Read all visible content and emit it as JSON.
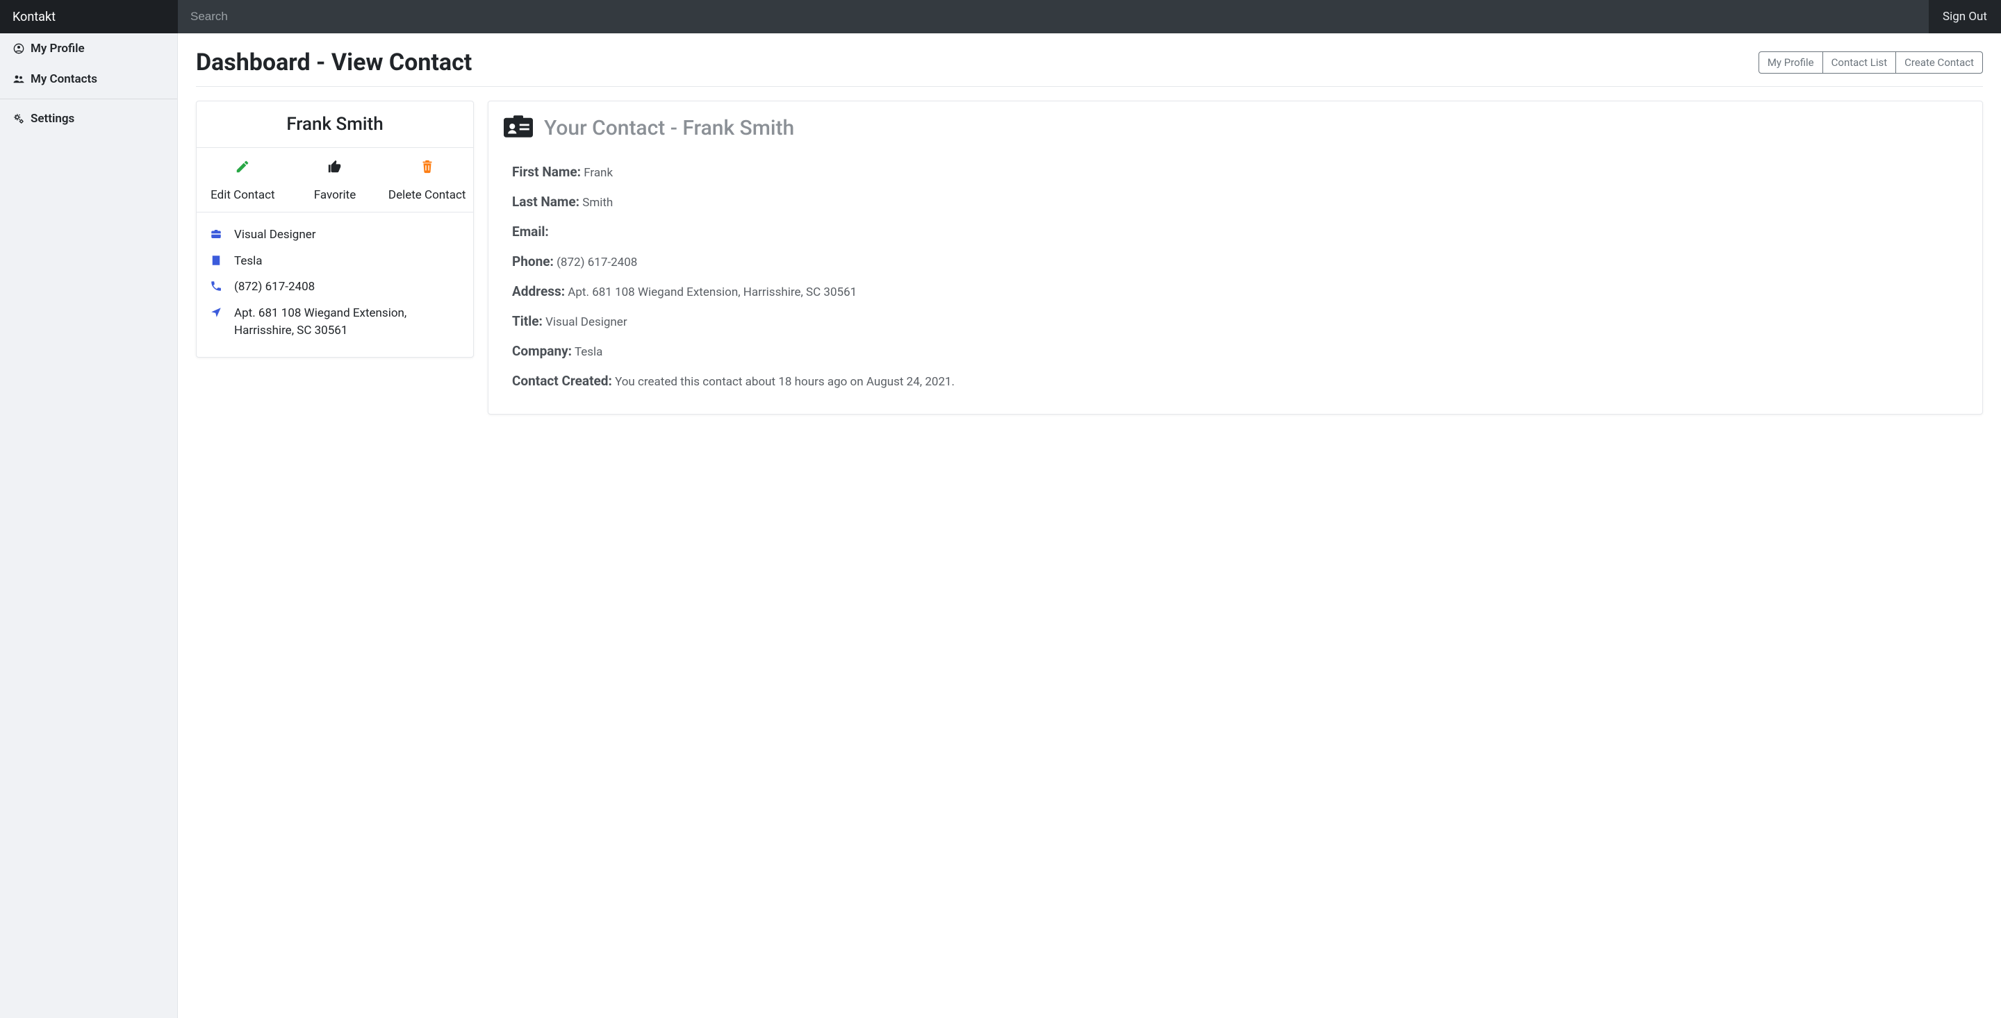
{
  "brand": "Kontakt",
  "search": {
    "placeholder": "Search"
  },
  "signout": "Sign Out",
  "sidebar": {
    "items": [
      {
        "label": "My Profile"
      },
      {
        "label": "My Contacts"
      },
      {
        "label": "Settings"
      }
    ]
  },
  "header": {
    "title": "Dashboard - View Contact",
    "buttons": [
      {
        "label": "My Profile"
      },
      {
        "label": "Contact List"
      },
      {
        "label": "Create Contact"
      }
    ]
  },
  "card": {
    "name": "Frank Smith",
    "actions": {
      "edit": "Edit Contact",
      "favorite": "Favorite",
      "delete": "Delete Contact"
    },
    "info": {
      "title": "Visual Designer",
      "company": "Tesla",
      "phone": "(872) 617-2408",
      "address": "Apt. 681 108 Wiegand Extension, Harrisshire, SC 30561"
    }
  },
  "details": {
    "heading": "Your Contact - Frank Smith",
    "labels": {
      "first_name": "First Name:",
      "last_name": "Last Name:",
      "email": "Email:",
      "phone": "Phone:",
      "address": "Address:",
      "title": "Title:",
      "company": "Company:",
      "created": "Contact Created:"
    },
    "values": {
      "first_name": "Frank",
      "last_name": "Smith",
      "email": "",
      "phone": "(872) 617-2408",
      "address": "Apt. 681 108 Wiegand Extension, Harrisshire, SC 30561",
      "title": "Visual Designer",
      "company": "Tesla",
      "created": "You created this contact about 18 hours ago on August 24, 2021."
    }
  }
}
